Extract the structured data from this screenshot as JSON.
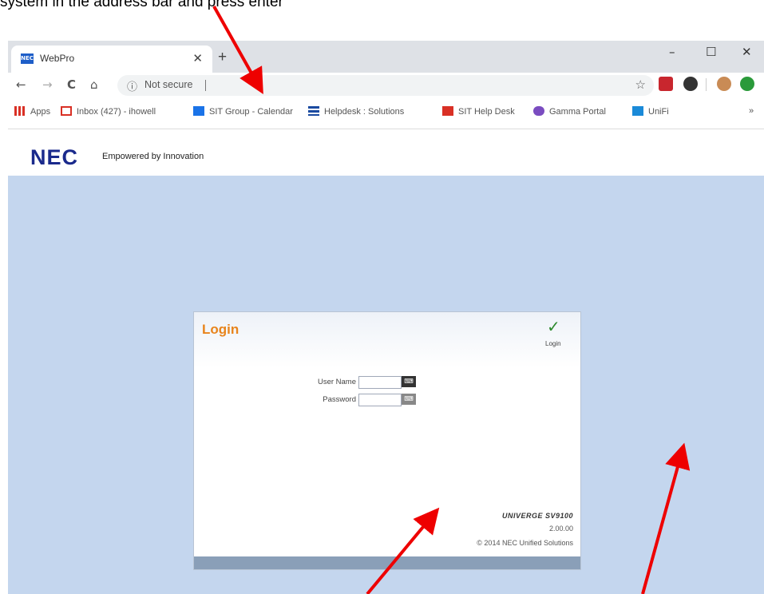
{
  "instruction": {
    "text": "system in the address bar and press enter"
  },
  "browser": {
    "tab_title": "WebPro",
    "tab_favicon_text": "NEC",
    "new_tab": "+",
    "window_controls": [
      "–",
      "☐",
      "✕"
    ],
    "nav": {
      "back": "←",
      "forward": "→",
      "reload": "C",
      "home": "⌂"
    },
    "address": {
      "security_icon": "ⓘ",
      "security_text": "Not secure",
      "url": ""
    },
    "bookmark_star": "☆",
    "bookmarks": [
      {
        "label": "Apps",
        "icon": "apps-icon",
        "color": "#d93025"
      },
      {
        "label": "Inbox (427) - ihowell",
        "icon": "gmail-icon",
        "color": "#d93025"
      },
      {
        "label": "SIT Group - Calendar",
        "icon": "calendar-icon",
        "color": "#1a73e8"
      },
      {
        "label": "Helpdesk : Solutions",
        "icon": "helpdesk-icon",
        "color": "#1a4aa0"
      },
      {
        "label": "SIT Help Desk",
        "icon": "helpdesk-red-icon",
        "color": "#d93025"
      },
      {
        "label": "Gamma Portal",
        "icon": "gamma-icon",
        "color": "#7a4cc0"
      },
      {
        "label": "UniFi",
        "icon": "unifi-icon",
        "color": "#1a8ad8"
      }
    ],
    "more_bookmarks": "»"
  },
  "header": {
    "logo": "NEC",
    "tagline": "Empowered by Innovation"
  },
  "login": {
    "title": "Login",
    "button_label": "Login",
    "username_label": "User Name",
    "password_label": "Password",
    "username_value": "",
    "password_value": "",
    "product": "UNIVERGE SV9100",
    "version": "2.00.00",
    "copyright": "© 2014 NEC Unified Solutions"
  },
  "colors": {
    "page_background": "#c4d6ee",
    "login_title": "#e8841c",
    "annotation_arrow": "#ee0000"
  }
}
